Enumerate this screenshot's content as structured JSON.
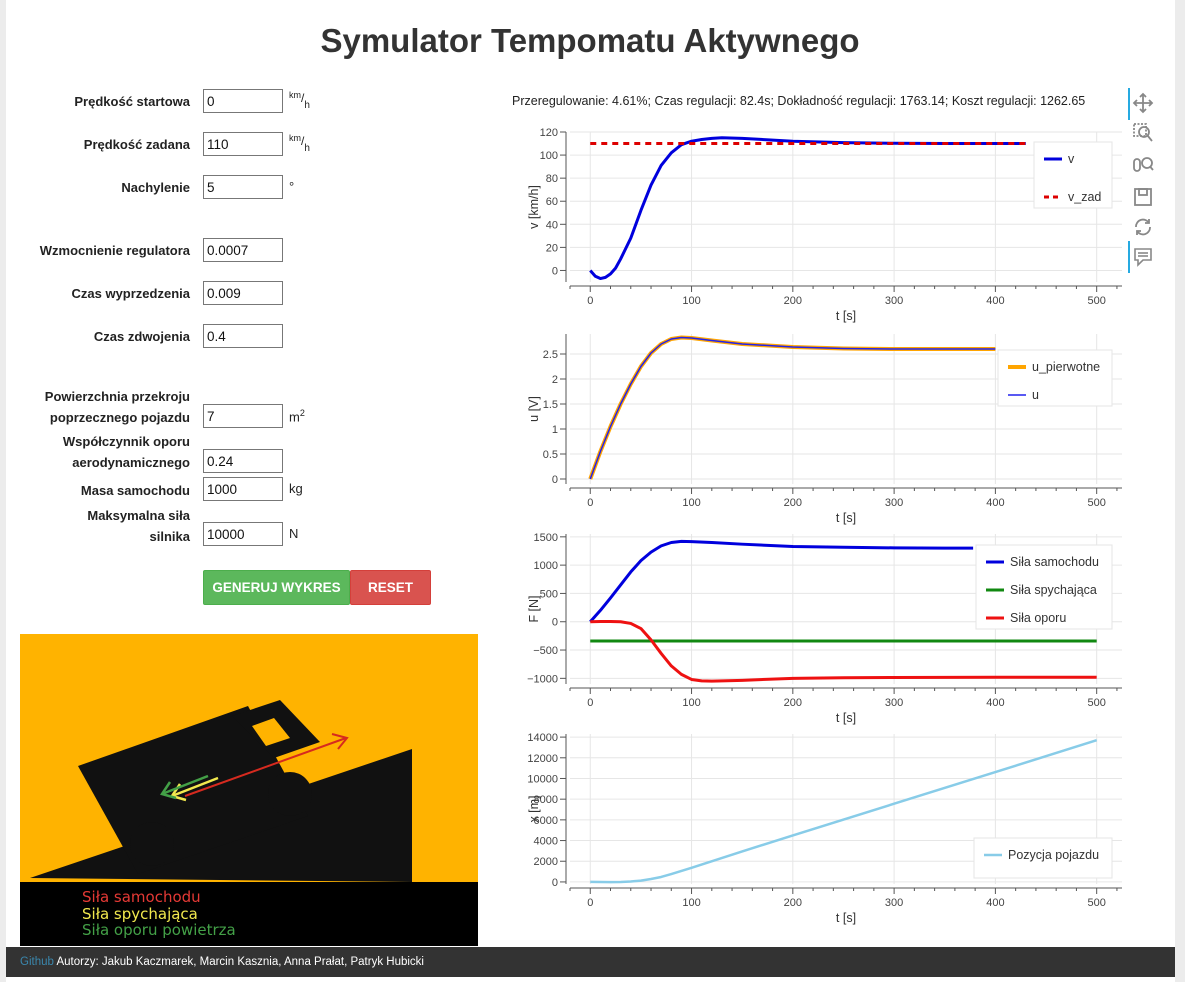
{
  "title": "Symulator Tempomatu Aktywnego",
  "form": {
    "fields": [
      {
        "name": "predkosc-startowa",
        "label": "Prędkość startowa",
        "value": "0",
        "unit_main": "km",
        "unit_sub": "h",
        "unit_type": "frac"
      },
      {
        "name": "predkosc-zadana",
        "label": "Prędkość zadana",
        "value": "110",
        "unit_main": "km",
        "unit_sub": "h",
        "unit_type": "frac"
      },
      {
        "name": "nachylenie",
        "label": "Nachylenie",
        "value": "5",
        "unit": "°"
      },
      {
        "name": "wzmocnienie",
        "label": "Wzmocnienie regulatora",
        "value": "0.0007"
      },
      {
        "name": "czas-wyprzedzenia",
        "label": "Czas wyprzedzenia",
        "value": "0.009"
      },
      {
        "name": "czas-zdwojenia",
        "label": "Czas zdwojenia",
        "value": "0.4"
      },
      {
        "name": "powierzchnia",
        "label_lines": [
          "Powierzchnia przekroju",
          "poprzecznego pojazdu"
        ],
        "value": "7",
        "unit": "m",
        "unit_sup": "2"
      },
      {
        "name": "wspolczynnik",
        "label_lines": [
          "Współczynnik oporu",
          "aerodynamicznego"
        ],
        "value": "0.24"
      },
      {
        "name": "masa",
        "label": "Masa samochodu",
        "value": "1000",
        "unit": "kg"
      },
      {
        "name": "sila",
        "label_lines": [
          "Maksymalna siła",
          "silnika"
        ],
        "value": "10000",
        "unit": "N"
      }
    ],
    "generate_label": "GENERUJ WYKRES",
    "reset_label": "RESET"
  },
  "illustration": {
    "bg_color": "#ffb300",
    "legend": [
      {
        "text": "Siła samochodu",
        "color": "#e53935"
      },
      {
        "text": "Siła spychająca",
        "color": "#f2e94e"
      },
      {
        "text": "Siła oporu powietrza",
        "color": "#43a047"
      }
    ]
  },
  "metrics": "Przeregulowanie: 4.61%; Czas regulacji: 82.4s; Dokładność regulacji: 1763.14; Koszt regulacji: 1262.65",
  "toolbar": [
    "pan-icon",
    "box-zoom-icon",
    "wheel-zoom-icon",
    "save-icon",
    "reset-icon",
    "hover-icon"
  ],
  "footer": {
    "link": "Github",
    "authors": "Autorzy: Jakub Kaczmarek, Marcin Kasznia, Anna Prałat, Patryk Hubicki"
  },
  "chart_data": [
    {
      "type": "line",
      "xlabel": "t [s]",
      "ylabel": "v [km/h]",
      "xlim": [
        -20,
        525
      ],
      "ylim": [
        -10,
        120
      ],
      "xticks": [
        0,
        100,
        200,
        300,
        400,
        500
      ],
      "yticks": [
        0,
        20,
        40,
        60,
        80,
        100,
        120
      ],
      "legend_position": "top-right",
      "series": [
        {
          "name": "v",
          "color": "#0000dd",
          "dash": "solid",
          "x": [
            0,
            5,
            10,
            15,
            20,
            25,
            30,
            40,
            50,
            60,
            70,
            80,
            90,
            100,
            110,
            120,
            130,
            150,
            200,
            250,
            300,
            350,
            400,
            430
          ],
          "y": [
            0,
            -5,
            -7,
            -6,
            -3,
            2,
            10,
            28,
            52,
            74,
            91,
            102,
            109,
            112,
            113.5,
            114.5,
            115,
            114.5,
            112,
            110.8,
            110.2,
            110,
            110,
            110
          ]
        },
        {
          "name": "v_zad",
          "color": "#dd0000",
          "dash": "dashed",
          "x": [
            0,
            430
          ],
          "y": [
            110,
            110
          ]
        }
      ]
    },
    {
      "type": "line",
      "xlabel": "t [s]",
      "ylabel": "u [V]",
      "xlim": [
        -20,
        525
      ],
      "ylim": [
        -0.1,
        2.9
      ],
      "xticks": [
        0,
        100,
        200,
        300,
        400,
        500
      ],
      "yticks": [
        0,
        0.5,
        1,
        1.5,
        2,
        2.5
      ],
      "legend_position": "top-right",
      "series": [
        {
          "name": "u_pierwotne",
          "color": "#ffa500",
          "width": 4,
          "x": [
            0,
            10,
            20,
            30,
            40,
            50,
            60,
            70,
            80,
            90,
            100,
            120,
            150,
            200,
            250,
            300,
            350,
            400
          ],
          "y": [
            0,
            0.55,
            1.05,
            1.5,
            1.9,
            2.25,
            2.52,
            2.7,
            2.8,
            2.83,
            2.82,
            2.77,
            2.7,
            2.64,
            2.61,
            2.6,
            2.6,
            2.6
          ]
        },
        {
          "name": "u",
          "color": "#2222ee",
          "width": 1.5,
          "x": [
            0,
            10,
            20,
            30,
            40,
            50,
            60,
            70,
            80,
            90,
            100,
            120,
            150,
            200,
            250,
            300,
            350,
            400
          ],
          "y": [
            0,
            0.55,
            1.05,
            1.5,
            1.9,
            2.25,
            2.52,
            2.7,
            2.8,
            2.83,
            2.82,
            2.77,
            2.7,
            2.64,
            2.61,
            2.6,
            2.6,
            2.6
          ]
        }
      ]
    },
    {
      "type": "line",
      "xlabel": "t [s]",
      "ylabel": "F [N]",
      "xlim": [
        -20,
        525
      ],
      "ylim": [
        -1100,
        1550
      ],
      "xticks": [
        0,
        100,
        200,
        300,
        400,
        500
      ],
      "yticks": [
        -1000,
        -500,
        0,
        500,
        1000,
        1500
      ],
      "yticklabels": [
        "−1000",
        "−500",
        "0",
        "500",
        "1000",
        "1500"
      ],
      "legend_position": "top-right",
      "series": [
        {
          "name": "Siła samochodu",
          "color": "#0000dd",
          "x": [
            0,
            10,
            20,
            30,
            40,
            50,
            60,
            70,
            80,
            90,
            100,
            120,
            150,
            200,
            250,
            300,
            350,
            378
          ],
          "y": [
            0,
            200,
            420,
            650,
            880,
            1080,
            1230,
            1340,
            1400,
            1420,
            1415,
            1400,
            1370,
            1330,
            1315,
            1305,
            1300,
            1300
          ]
        },
        {
          "name": "Siła spychająca",
          "color": "#118811",
          "x": [
            0,
            500
          ],
          "y": [
            -340,
            -340
          ]
        },
        {
          "name": "Siła oporu",
          "color": "#ee1111",
          "x": [
            0,
            10,
            20,
            30,
            40,
            50,
            60,
            70,
            80,
            90,
            100,
            110,
            120,
            150,
            200,
            250,
            300,
            400,
            500
          ],
          "y": [
            0,
            5,
            5,
            0,
            -30,
            -120,
            -320,
            -560,
            -780,
            -930,
            -1020,
            -1045,
            -1050,
            -1035,
            -1000,
            -990,
            -985,
            -980,
            -980
          ]
        }
      ]
    },
    {
      "type": "line",
      "xlabel": "t [s]",
      "ylabel": "x [m]",
      "xlim": [
        -20,
        525
      ],
      "ylim": [
        -200,
        14300
      ],
      "xticks": [
        0,
        100,
        200,
        300,
        400,
        500
      ],
      "yticks": [
        0,
        2000,
        4000,
        6000,
        8000,
        10000,
        12000,
        14000
      ],
      "legend_position": "bottom-right",
      "series": [
        {
          "name": "Pozycja pojazdu",
          "color": "#88cce8",
          "width": 2.5,
          "x": [
            0,
            10,
            20,
            30,
            40,
            50,
            60,
            70,
            80,
            90,
            100,
            150,
            200,
            300,
            400,
            500
          ],
          "y": [
            0,
            -8,
            -15,
            -5,
            40,
            130,
            280,
            480,
            760,
            1060,
            1370,
            2950,
            4500,
            7560,
            10620,
            13700
          ]
        }
      ]
    }
  ]
}
